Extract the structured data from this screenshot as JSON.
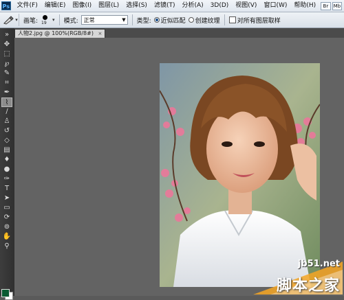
{
  "menubar": {
    "logo": "Ps",
    "items": [
      "文件(F)",
      "编辑(E)",
      "图像(I)",
      "图层(L)",
      "选择(S)",
      "滤镜(T)",
      "分析(A)",
      "3D(D)",
      "视图(V)",
      "窗口(W)",
      "帮助(H)"
    ],
    "right_buttons": [
      "Br",
      "Mb"
    ]
  },
  "options": {
    "brush_label": "画笔:",
    "brush_size": "19",
    "mode_label": "模式:",
    "mode_value": "正常",
    "type_label": "类型:",
    "radio1": "近似匹配",
    "radio2": "创建纹理",
    "checkbox_label": "对所有图层取样"
  },
  "document": {
    "tab_title": "人物2.jpg @ 100%(RGB/8#)",
    "close": "×"
  },
  "watermark": {
    "url": "jb51.net",
    "name": "脚本之家"
  },
  "colors": {
    "foreground": "#0a5a32",
    "background": "#ffffff"
  }
}
